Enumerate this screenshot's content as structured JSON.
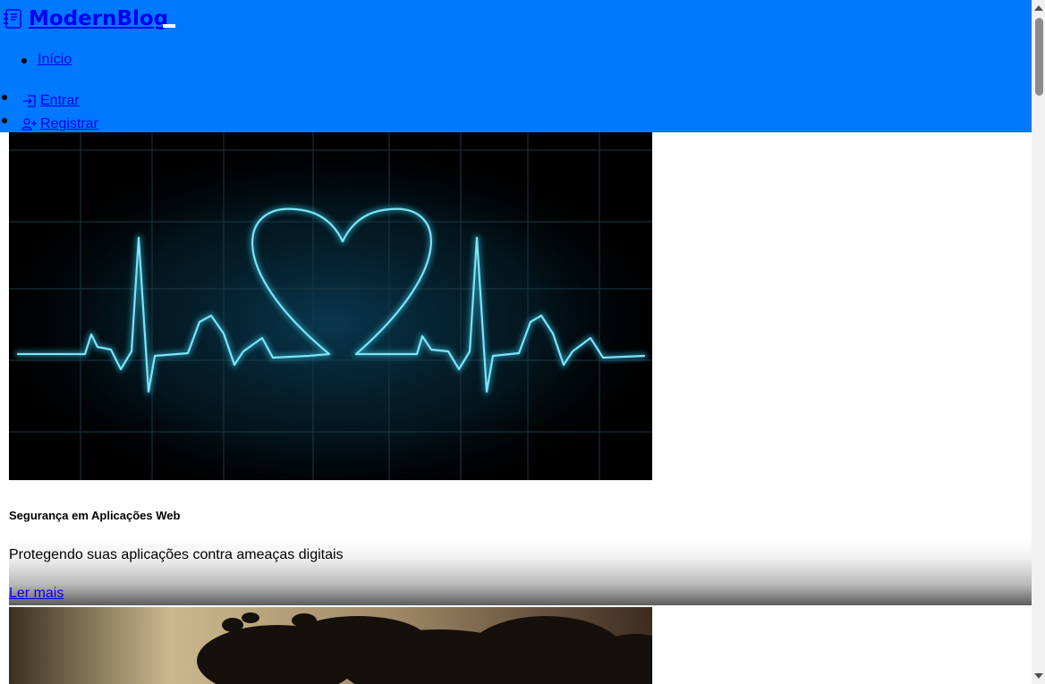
{
  "header": {
    "brand": {
      "icon": "journal-text-icon",
      "label": "ModernBlog"
    },
    "nav": [
      {
        "label": "Início"
      }
    ],
    "auth": [
      {
        "icon": "box-arrow-in-icon",
        "label": "Entrar"
      },
      {
        "icon": "person-plus-icon",
        "label": "Registrar"
      }
    ],
    "colors": {
      "navbar_bg": "#0078ff",
      "link": "#0000ee"
    }
  },
  "posts": [
    {
      "image": "heartbeat-heart-ecg-image",
      "title": "Segurança em Aplicações Web",
      "excerpt": "Protegendo suas aplicações contra ameaças digitais",
      "cta": "Ler mais"
    },
    {
      "image": "tree-silhouette-sunset-image"
    }
  ]
}
